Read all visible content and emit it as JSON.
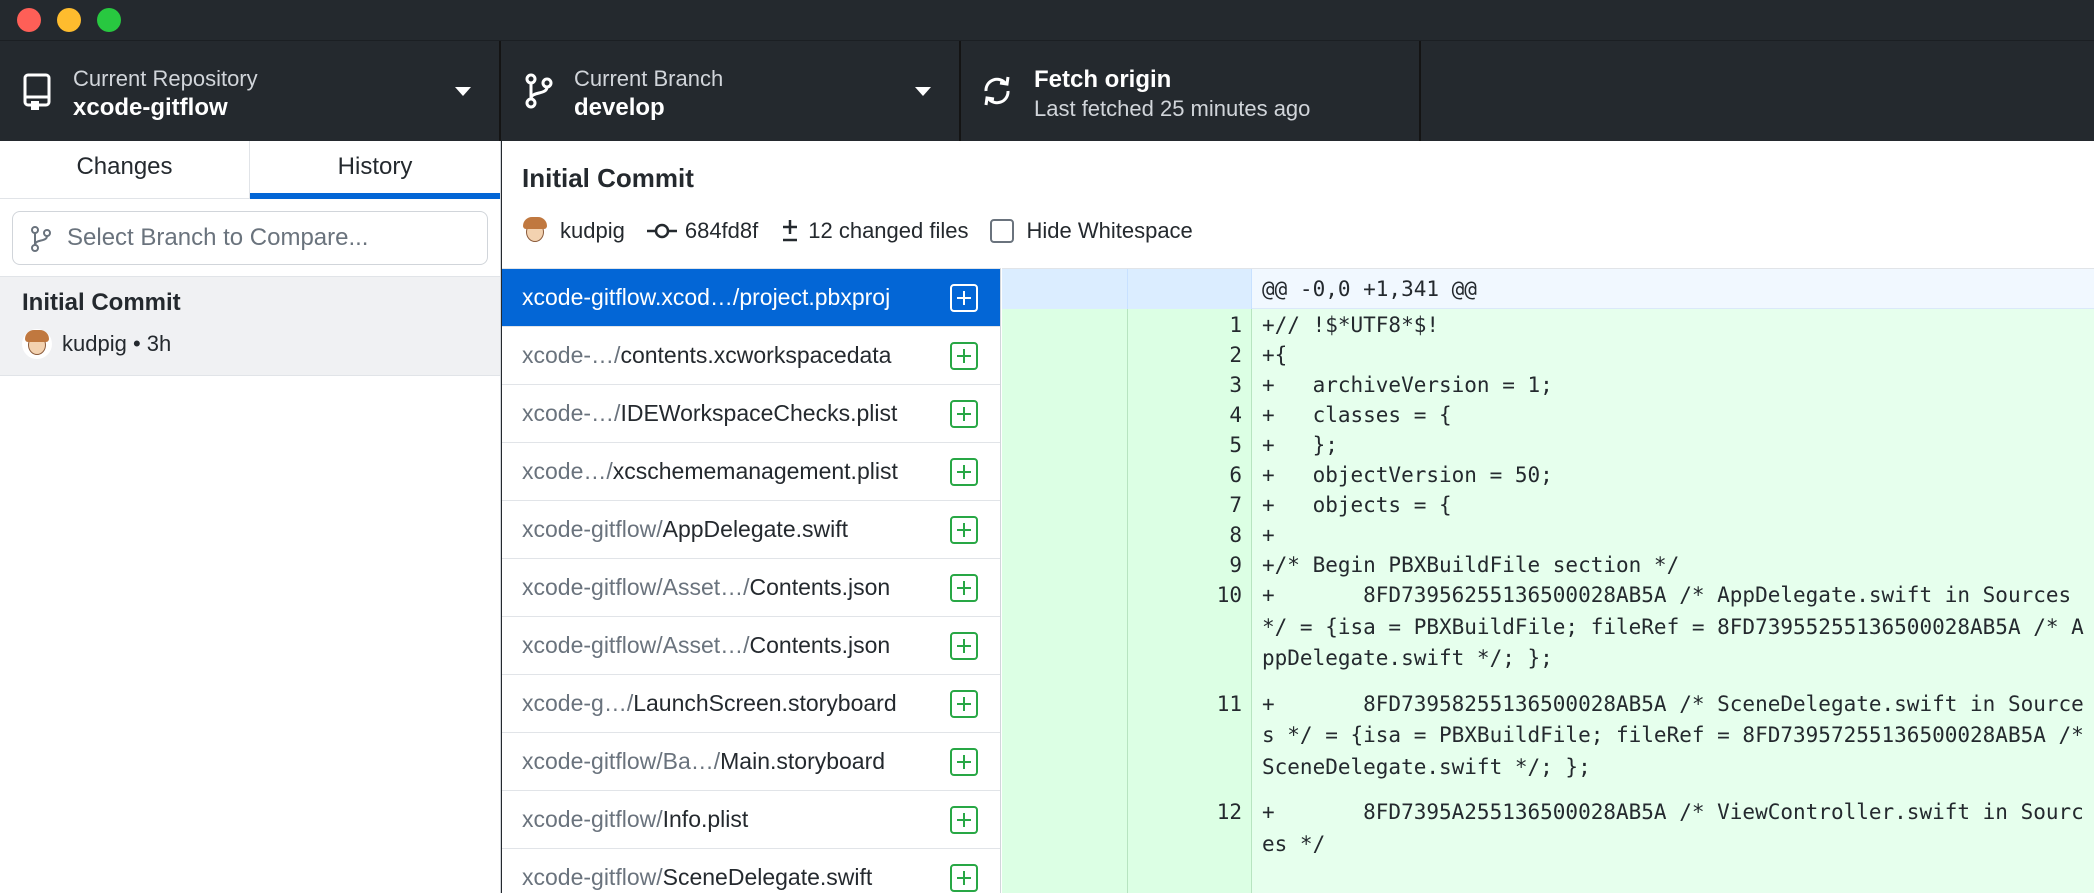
{
  "window": {
    "controls": [
      "close",
      "minimize",
      "zoom"
    ]
  },
  "toolbar": {
    "repository": {
      "label": "Current Repository",
      "value": "xcode-gitflow",
      "icon": "repo-icon"
    },
    "branch": {
      "label": "Current Branch",
      "value": "develop",
      "icon": "git-branch-icon"
    },
    "fetch": {
      "label": "Fetch origin",
      "value": "Last fetched 25 minutes ago",
      "icon": "sync-icon"
    }
  },
  "sidebar": {
    "tabs": [
      {
        "label": "Changes",
        "active": false
      },
      {
        "label": "History",
        "active": true
      }
    ],
    "compare_placeholder": "Select Branch to Compare...",
    "commits": [
      {
        "title": "Initial Commit",
        "author": "kudpig",
        "meta": "kudpig • 3h"
      }
    ]
  },
  "commit": {
    "title": "Initial Commit",
    "author": "kudpig",
    "sha": "684fd8f",
    "changed_files": "12 changed files",
    "hide_whitespace_label": "Hide Whitespace"
  },
  "files": [
    {
      "dir": "xcode-gitflow.xcod…/",
      "name": "project.pbxproj",
      "selected": true
    },
    {
      "dir": "xcode-…/",
      "name": "contents.xcworkspacedata",
      "selected": false
    },
    {
      "dir": "xcode-…/",
      "name": "IDEWorkspaceChecks.plist",
      "selected": false
    },
    {
      "dir": "xcode…/",
      "name": "xcschememanagement.plist",
      "selected": false
    },
    {
      "dir": "xcode-gitflow/",
      "name": "AppDelegate.swift",
      "selected": false
    },
    {
      "dir": "xcode-gitflow/Asset…/",
      "name": "Contents.json",
      "selected": false
    },
    {
      "dir": "xcode-gitflow/Asset…/",
      "name": "Contents.json",
      "selected": false
    },
    {
      "dir": "xcode-g…/",
      "name": "LaunchScreen.storyboard",
      "selected": false
    },
    {
      "dir": "xcode-gitflow/Ba…/",
      "name": "Main.storyboard",
      "selected": false
    },
    {
      "dir": "xcode-gitflow/",
      "name": "Info.plist",
      "selected": false
    },
    {
      "dir": "xcode-gitflow/",
      "name": "SceneDelegate.swift",
      "selected": false
    }
  ],
  "diff": {
    "hunk": "@@ -0,0 +1,341 @@",
    "lines": [
      {
        "no": "1",
        "code": "+// !$*UTF8*$!"
      },
      {
        "no": "2",
        "code": "+{"
      },
      {
        "no": "3",
        "code": "+   archiveVersion = 1;"
      },
      {
        "no": "4",
        "code": "+   classes = {"
      },
      {
        "no": "5",
        "code": "+   };"
      },
      {
        "no": "6",
        "code": "+   objectVersion = 50;"
      },
      {
        "no": "7",
        "code": "+   objects = {"
      },
      {
        "no": "8",
        "code": "+"
      },
      {
        "no": "9",
        "code": "+/* Begin PBXBuildFile section */"
      },
      {
        "no": "10",
        "code": "+       8FD73956255136500028AB5A /* AppDelegate.swift in Sources */ = {isa = PBXBuildFile; fileRef = 8FD73955255136500028AB5A /* AppDelegate.swift */; };"
      },
      {
        "no": "11",
        "code": "+       8FD73958255136500028AB5A /* SceneDelegate.swift in Sources */ = {isa = PBXBuildFile; fileRef = 8FD73957255136500028AB5A /* SceneDelegate.swift */; };"
      },
      {
        "no": "12",
        "code": "+       8FD7395A255136500028AB5A /* ViewController.swift in Sources */"
      }
    ]
  }
}
